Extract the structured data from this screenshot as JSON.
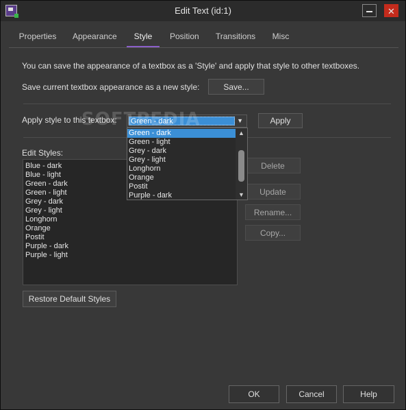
{
  "window": {
    "title": "Edit Text (id:1)",
    "close_glyph": "✕"
  },
  "tabs": [
    {
      "label": "Properties"
    },
    {
      "label": "Appearance"
    },
    {
      "label": "Style"
    },
    {
      "label": "Position"
    },
    {
      "label": "Transitions"
    },
    {
      "label": "Misc"
    }
  ],
  "active_tab": "Style",
  "style_tab": {
    "info": "You can save the appearance of a textbox as a 'Style' and apply that style to other textboxes.",
    "save_label": "Save current textbox appearance as a new style:",
    "save_button": "Save...",
    "apply_label": "Apply style to this textbox:",
    "apply_button": "Apply",
    "combo_value": "Green - dark",
    "dropdown_options": [
      "Green - dark",
      "Green - light",
      "Grey - dark",
      "Grey - light",
      "Longhorn",
      "Orange",
      "Postit",
      "Purple - dark"
    ],
    "edit_styles_label": "Edit Styles:",
    "styles": [
      "Blue - dark",
      "Blue - light",
      "Green - dark",
      "Green - light",
      "Grey - dark",
      "Grey - light",
      "Longhorn",
      "Orange",
      "Postit",
      "Purple - dark",
      "Purple - light"
    ],
    "delete_button": "Delete",
    "update_button": "Update",
    "rename_button": "Rename...",
    "copy_button": "Copy...",
    "restore_button": "Restore Default Styles"
  },
  "footer": {
    "ok": "OK",
    "cancel": "Cancel",
    "help": "Help"
  },
  "watermark": "SOFTPEDIA",
  "colors": {
    "accent": "#8a5fc9",
    "selection": "#3b8fd6",
    "close": "#c42b1c"
  }
}
